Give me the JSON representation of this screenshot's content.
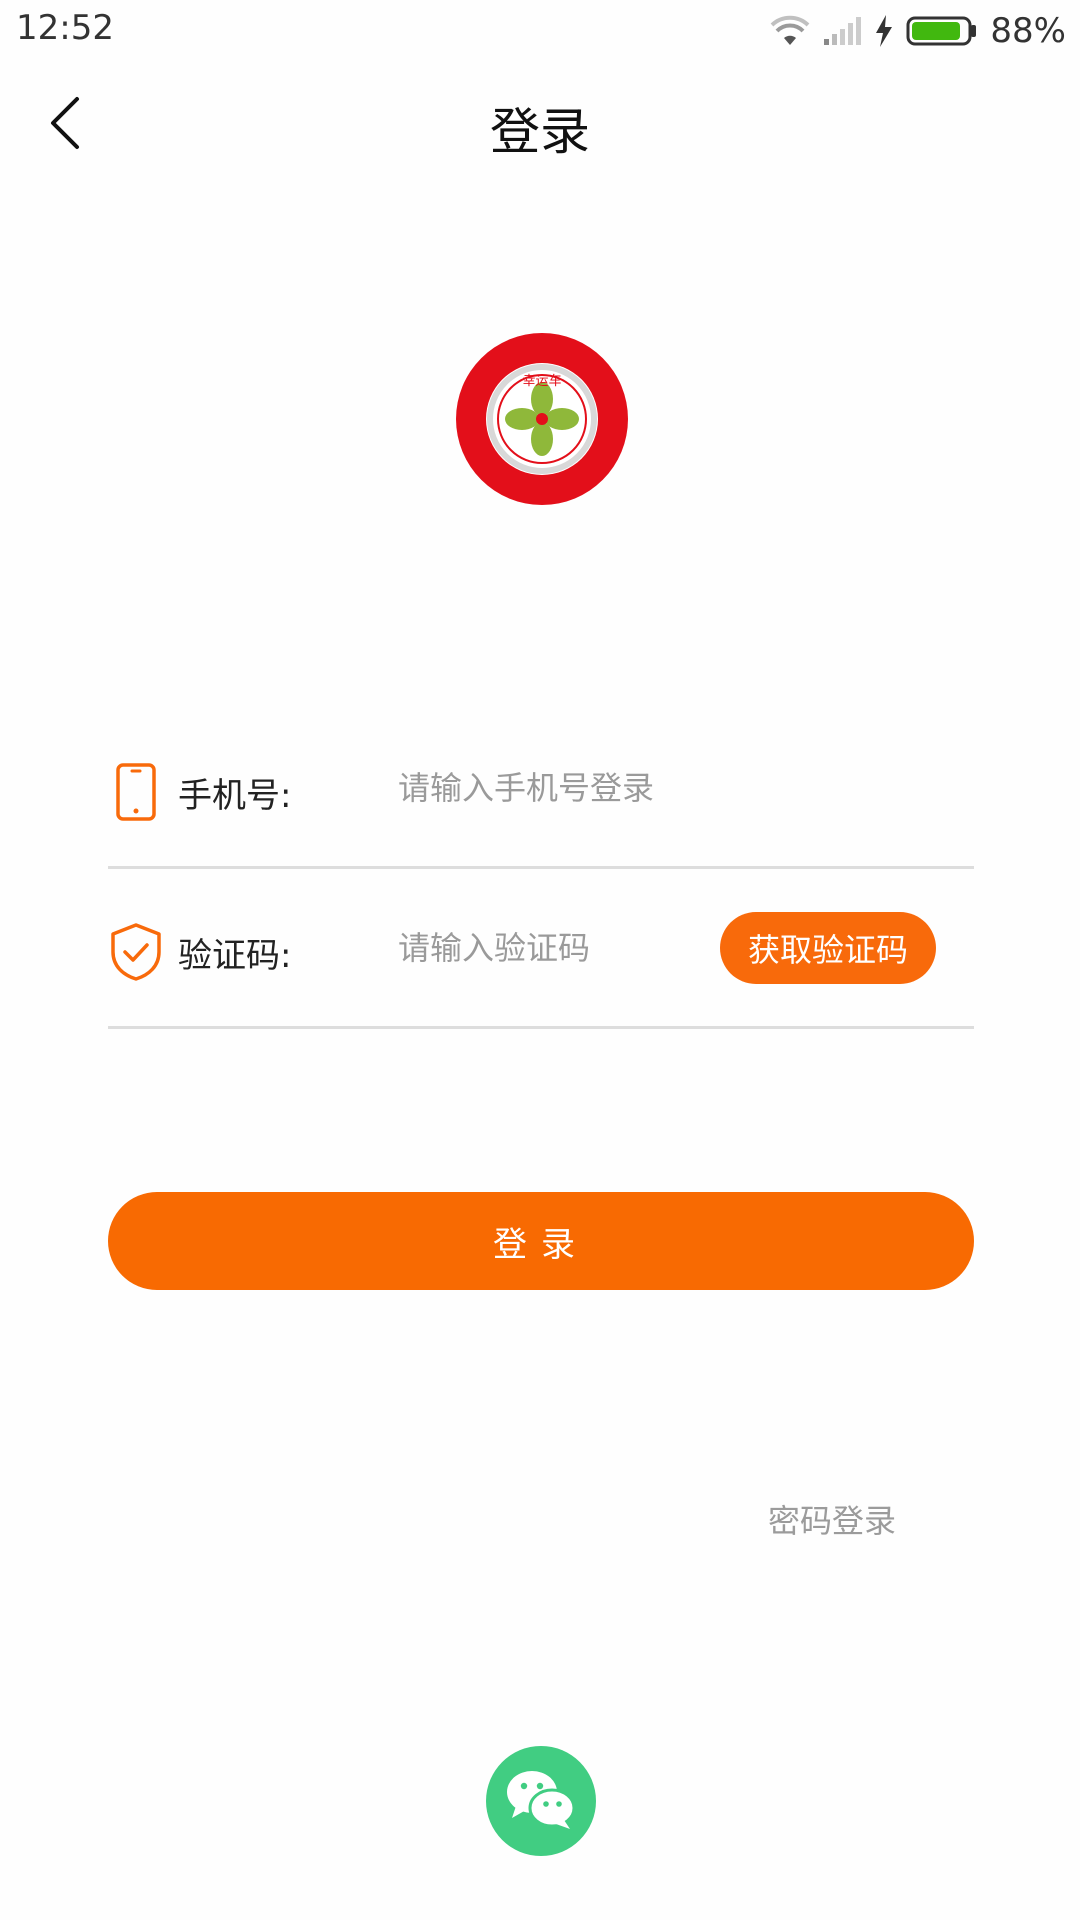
{
  "status_bar": {
    "time": "12:52",
    "battery_percent": "88%",
    "battery_level": 0.88,
    "icons": [
      "wifi-icon",
      "signal-icon",
      "charging-icon",
      "battery-icon"
    ]
  },
  "header": {
    "title": "登录",
    "back_icon": "chevron-left-icon"
  },
  "logo": {
    "text": "幸运车",
    "colors": {
      "outer": "#e30f1a",
      "ring": "#ffffff",
      "clover": "#8fb83a"
    }
  },
  "form": {
    "phone": {
      "label": "手机号:",
      "placeholder": "请输入手机号登录",
      "value": "",
      "icon": "phone-icon"
    },
    "code": {
      "label": "验证码:",
      "placeholder": "请输入验证码",
      "value": "",
      "icon": "shield-check-icon",
      "get_code_label": "获取验证码"
    }
  },
  "login_button": {
    "label": "登录"
  },
  "password_login_link": "密码登录",
  "wechat": {
    "icon": "wechat-icon"
  },
  "colors": {
    "accent": "#f86a02",
    "wechat": "#41cd82",
    "divider": "#dddddd",
    "placeholder": "#9a9a9a"
  }
}
